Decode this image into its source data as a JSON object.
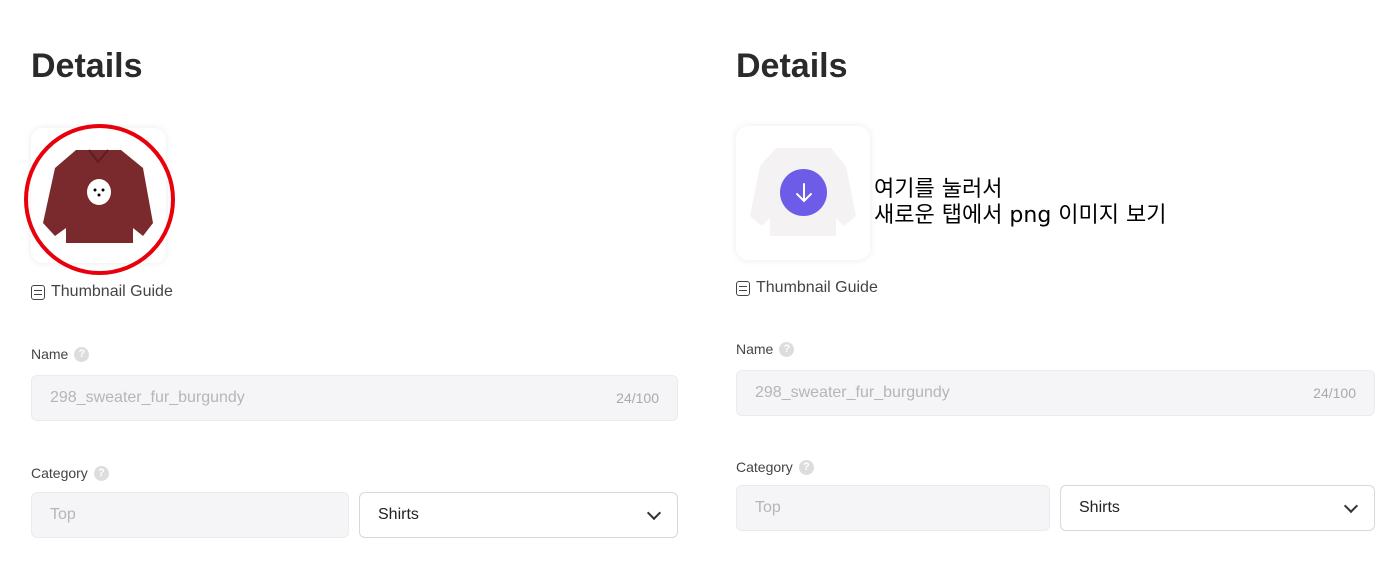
{
  "left": {
    "title": "Details",
    "thumbnail_guide": "Thumbnail Guide",
    "name_label": "Name",
    "name_value": "298_sweater_fur_burgundy",
    "name_count": "24/100",
    "category_label": "Category",
    "category_primary": "Top",
    "category_secondary": "Shirts",
    "help": "?"
  },
  "right": {
    "title": "Details",
    "thumbnail_guide": "Thumbnail Guide",
    "name_label": "Name",
    "name_value": "298_sweater_fur_burgundy",
    "name_count": "24/100",
    "category_label": "Category",
    "category_primary": "Top",
    "category_secondary": "Shirts",
    "help": "?"
  },
  "annotation": {
    "line1": "여기를 눌러서",
    "line2": "새로운 탭에서 png 이미지 보기"
  },
  "colors": {
    "highlight_circle": "#e8000b",
    "download_button": "#6c5ce7",
    "sweater": "#7a2a2c"
  },
  "icons": [
    "guide-icon",
    "help-icon",
    "chevron-down-icon",
    "download-icon"
  ]
}
